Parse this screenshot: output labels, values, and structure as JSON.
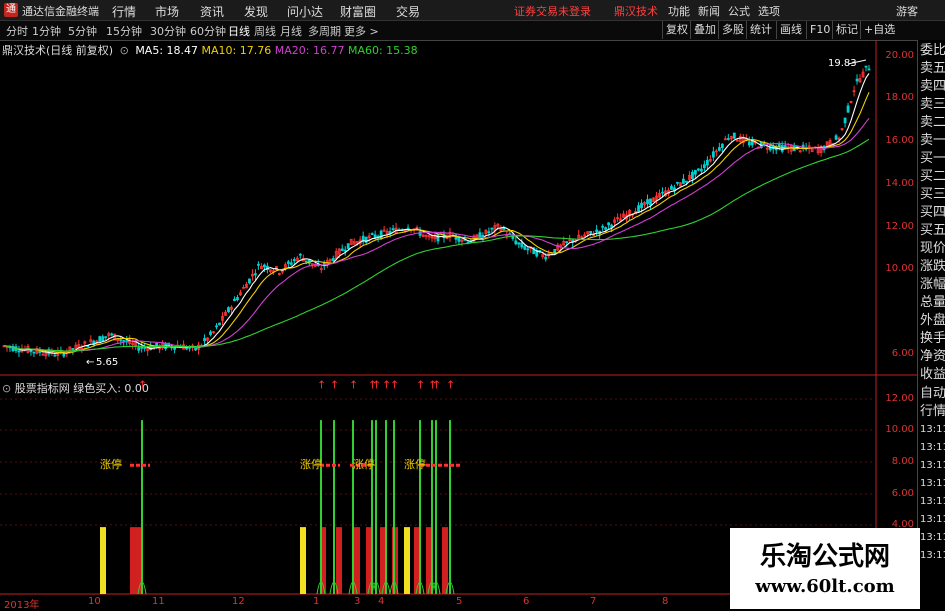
{
  "menubar": {
    "app_title": "通达信金融终端",
    "items": [
      "行情",
      "市场",
      "资讯",
      "发现",
      "问小达",
      "财富圈",
      "交易"
    ],
    "status": "证券交易未登录",
    "brand": "鼎汉技术",
    "right_items": [
      "功能",
      "新闻",
      "公式",
      "选项"
    ],
    "guest": "游客"
  },
  "tabs": [
    "分时",
    "1分钟",
    "5分钟",
    "15分钟",
    "30分钟",
    "60分钟",
    "日线",
    "周线",
    "月线",
    "多周期",
    "更多 >"
  ],
  "active_tab": "日线",
  "toolbar_right": [
    "复权",
    "叠加",
    "多股",
    "统计",
    "画线",
    "F10",
    "标记",
    "+自选"
  ],
  "main_chart": {
    "stock_name": "鼎汉技术(日线 前复权)",
    "ma_labels": [
      {
        "text": "MA5: 18.47",
        "color": "#ffffff"
      },
      {
        "text": "MA10: 17.76",
        "color": "#f0d000"
      },
      {
        "text": "MA20: 16.77",
        "color": "#d040d0"
      },
      {
        "text": "MA60: 15.38",
        "color": "#30d030"
      }
    ],
    "high_label": "19.83",
    "low_label": "5.65",
    "y_ticks": [
      "20.00",
      "18.00",
      "16.00",
      "14.00",
      "12.00",
      "10.00",
      "8.00",
      "6.00"
    ]
  },
  "sub_chart": {
    "title": "股票指标网",
    "indicator": "绿色买入: 0.00",
    "y_ticks": [
      "12.00",
      "10.00",
      "8.00",
      "6.00",
      "4.00"
    ],
    "zt_label": "涨停"
  },
  "side_labels": [
    "委比",
    "卖五",
    "卖四",
    "卖三",
    "卖二",
    "卖一",
    "买一",
    "买二",
    "买三",
    "买四",
    "买五",
    "现价",
    "涨跌",
    "涨幅",
    "总量",
    "外盘",
    "换手",
    "净资",
    "收益"
  ],
  "side_lower": [
    "自动",
    "行情",
    "13:11",
    "13:11",
    "13:11",
    "13:11",
    "13:11",
    "13:11",
    "13:11",
    "13:11"
  ],
  "x_dates": [
    "2013年",
    "10",
    "11",
    "12",
    "1",
    "3",
    "4",
    "5",
    "6",
    "7",
    "8"
  ],
  "watermark": {
    "line1": "乐淘公式网",
    "line2": "www.60lt.com"
  },
  "colors": {
    "up": "#ff3333",
    "down": "#00d0d0",
    "ma5": "#ffffff",
    "ma10": "#f0d000",
    "ma20": "#d040d0",
    "ma60": "#30d030",
    "axis": "#c02020"
  }
}
